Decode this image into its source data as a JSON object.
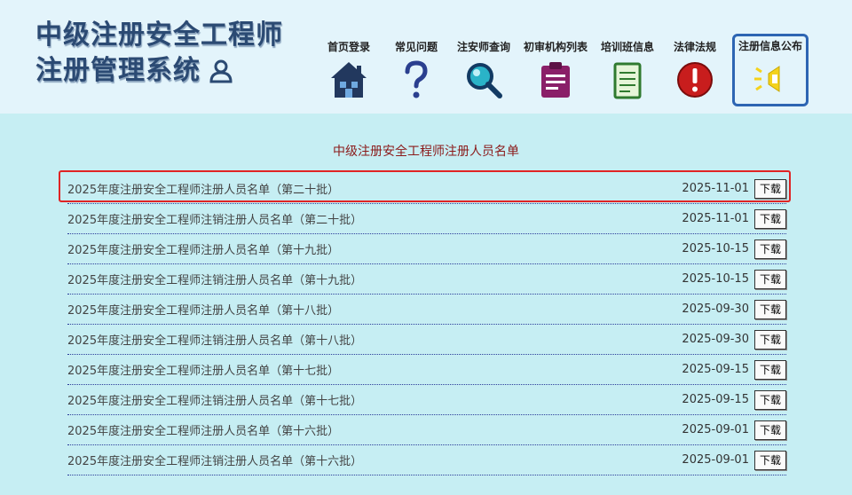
{
  "brand": {
    "line1": "中级注册安全工程师",
    "line2": "注册管理系统"
  },
  "nav": [
    {
      "label": "首页登录",
      "icon": "house-icon"
    },
    {
      "label": "常见问题",
      "icon": "question-icon"
    },
    {
      "label": "注安师查询",
      "icon": "magnifier-icon"
    },
    {
      "label": "初审机构列表",
      "icon": "clipboard-icon"
    },
    {
      "label": "培训班信息",
      "icon": "notepad-icon"
    },
    {
      "label": "法律法规",
      "icon": "alert-icon"
    },
    {
      "label": "注册信息公布",
      "icon": "megaphone-icon",
      "active": true
    }
  ],
  "list_title": "中级注册安全工程师注册人员名单",
  "download_label": "下载",
  "rows": [
    {
      "title": "2025年度注册安全工程师注册人员名单（第二十批）",
      "date": "2025-11-01"
    },
    {
      "title": "2025年度注册安全工程师注销注册人员名单（第二十批）",
      "date": "2025-11-01"
    },
    {
      "title": "2025年度注册安全工程师注册人员名单（第十九批）",
      "date": "2025-10-15"
    },
    {
      "title": "2025年度注册安全工程师注销注册人员名单（第十九批）",
      "date": "2025-10-15"
    },
    {
      "title": "2025年度注册安全工程师注册人员名单（第十八批）",
      "date": "2025-09-30"
    },
    {
      "title": "2025年度注册安全工程师注销注册人员名单（第十八批）",
      "date": "2025-09-30"
    },
    {
      "title": "2025年度注册安全工程师注册人员名单（第十七批）",
      "date": "2025-09-15"
    },
    {
      "title": "2025年度注册安全工程师注销注册人员名单（第十七批）",
      "date": "2025-09-15"
    },
    {
      "title": "2025年度注册安全工程师注册人员名单（第十六批）",
      "date": "2025-09-01"
    },
    {
      "title": "2025年度注册安全工程师注销注册人员名单（第十六批）",
      "date": "2025-09-01"
    }
  ],
  "colors": {
    "accent_border": "#2d65b3",
    "highlight": "#e02424",
    "title_red": "#8b1a1a"
  }
}
